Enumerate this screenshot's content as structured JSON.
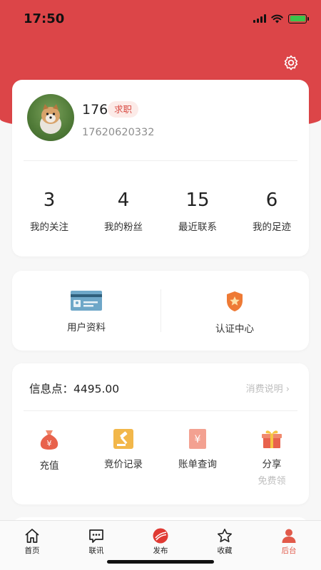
{
  "status_bar": {
    "time": "17:50"
  },
  "profile": {
    "name": "176",
    "badge": "求职",
    "phone": "17620620332"
  },
  "stats": [
    {
      "value": "3",
      "label": "我的关注"
    },
    {
      "value": "4",
      "label": "我的粉丝"
    },
    {
      "value": "15",
      "label": "最近联系"
    },
    {
      "value": "6",
      "label": "我的足迹"
    }
  ],
  "tools": [
    {
      "label": "用户资料",
      "icon": "id-card-icon"
    },
    {
      "label": "认证中心",
      "icon": "shield-star-icon"
    }
  ],
  "wallet": {
    "points_label": "信息点：",
    "points_value": "4495.00",
    "link": "消费说明",
    "actions": [
      {
        "label": "充值",
        "icon": "money-bag-icon"
      },
      {
        "label": "竞价记录",
        "icon": "gavel-icon"
      },
      {
        "label": "账单查询",
        "icon": "bill-icon"
      },
      {
        "label": "分享",
        "sub": "免费领",
        "icon": "gift-icon"
      }
    ]
  },
  "tabbar": [
    {
      "label": "首页",
      "icon": "home-icon"
    },
    {
      "label": "联讯",
      "icon": "chat-icon"
    },
    {
      "label": "发布",
      "icon": "publish-icon"
    },
    {
      "label": "收藏",
      "icon": "star-icon"
    },
    {
      "label": "后台",
      "icon": "user-icon",
      "active": true
    }
  ],
  "colors": {
    "brand_red": "#dc4548",
    "accent_orange": "#e15a4a",
    "muted": "#bdbdbd"
  }
}
